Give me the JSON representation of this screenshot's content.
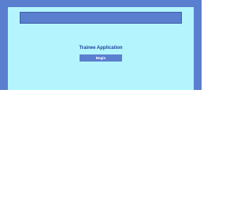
{
  "header": {
    "line1": "",
    "line2": ""
  },
  "main": {
    "title": "Trainee Application",
    "begin_label": "Begin"
  },
  "colors": {
    "frame": "#5b7fcf",
    "panel": "#b4f5fd",
    "title_text": "#20449a",
    "button_bg": "#5b7fcf",
    "button_text": "#ffffff"
  }
}
